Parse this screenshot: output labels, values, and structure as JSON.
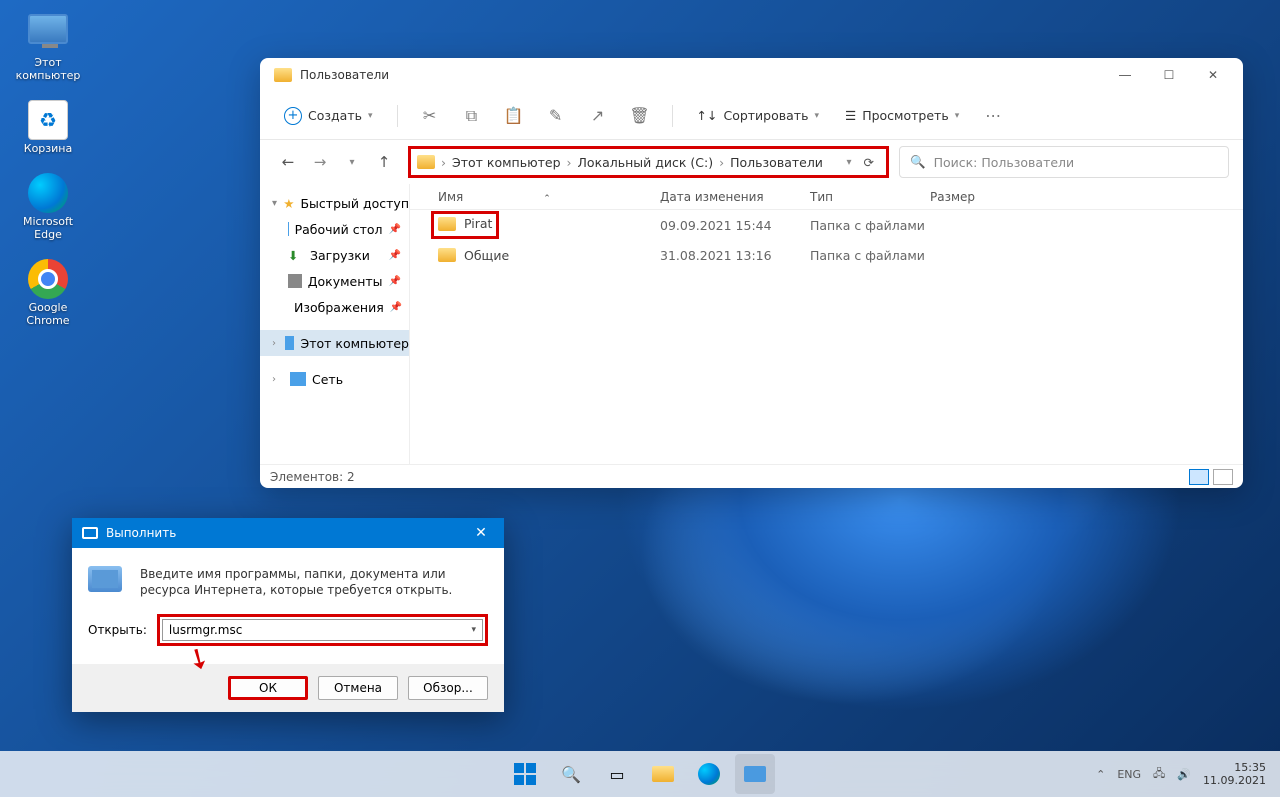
{
  "desktop": {
    "icons": [
      {
        "label": "Этот\nкомпьютер"
      },
      {
        "label": "Корзина"
      },
      {
        "label": "Microsoft\nEdge"
      },
      {
        "label": "Google\nChrome"
      }
    ]
  },
  "explorer": {
    "title": "Пользователи",
    "toolbar": {
      "create": "Создать",
      "sort": "Сортировать",
      "view": "Просмотреть"
    },
    "breadcrumb": [
      "Этот компьютер",
      "Локальный диск (C:)",
      "Пользователи"
    ],
    "search_placeholder": "Поиск: Пользователи",
    "columns": {
      "name": "Имя",
      "date": "Дата изменения",
      "type": "Тип",
      "size": "Размер"
    },
    "sidebar": {
      "quick": "Быстрый доступ",
      "items": [
        "Рабочий стол",
        "Загрузки",
        "Документы",
        "Изображения"
      ],
      "this_pc": "Этот компьютер",
      "network": "Сеть"
    },
    "rows": [
      {
        "name": "Pirat",
        "date": "09.09.2021 15:44",
        "type": "Папка с файлами"
      },
      {
        "name": "Общие",
        "date": "31.08.2021 13:16",
        "type": "Папка с файлами"
      }
    ],
    "status": "Элементов: 2"
  },
  "run": {
    "title": "Выполнить",
    "desc": "Введите имя программы, папки, документа или ресурса Интернета, которые требуется открыть.",
    "open_label": "Открыть:",
    "value": "lusrmgr.msc",
    "ok": "ОК",
    "cancel": "Отмена",
    "browse": "Обзор..."
  },
  "taskbar": {
    "lang": "ENG",
    "time": "15:35",
    "date": "11.09.2021"
  }
}
